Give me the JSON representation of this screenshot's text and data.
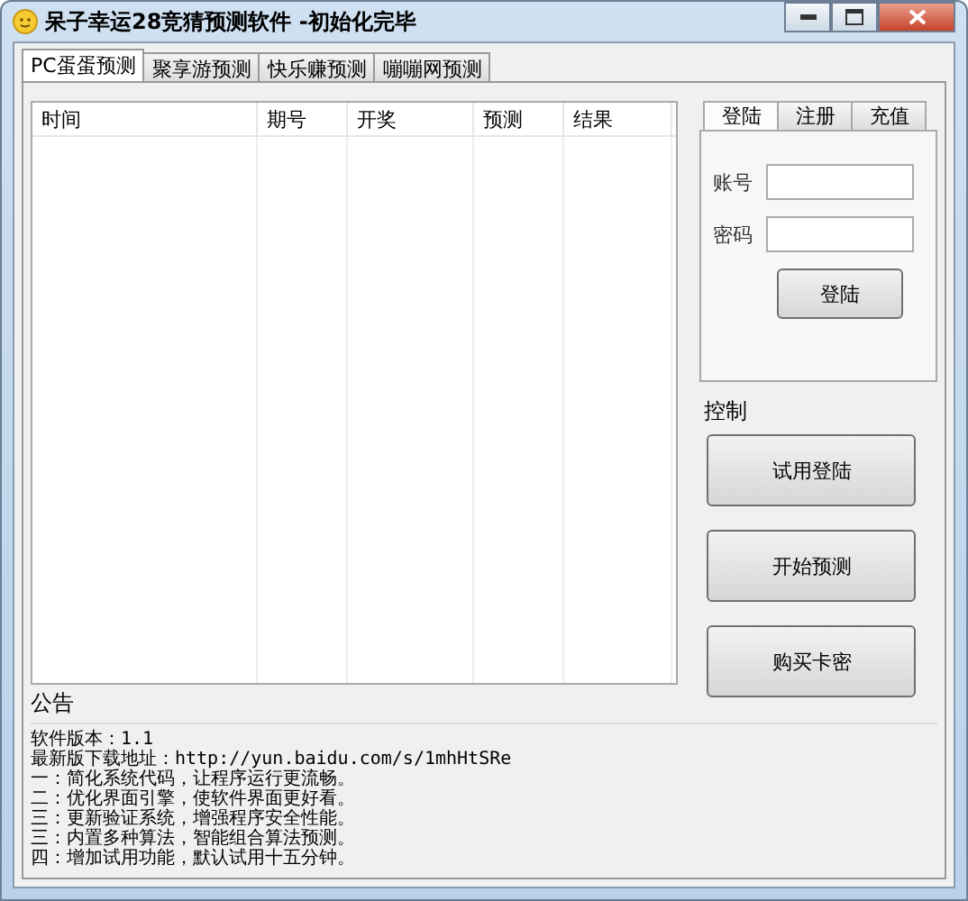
{
  "window": {
    "title": "呆子幸运28竞猜预测软件 -初始化完毕"
  },
  "tabs": [
    {
      "label": "PC蛋蛋预测",
      "selected": true
    },
    {
      "label": "聚享游预测",
      "selected": false
    },
    {
      "label": "快乐赚预测",
      "selected": false
    },
    {
      "label": "嘣嘣网预测",
      "selected": false
    }
  ],
  "table": {
    "columns": [
      "时间",
      "期号",
      "开奖",
      "预测",
      "结果"
    ]
  },
  "account": {
    "tabs": [
      {
        "label": "登陆",
        "selected": true
      },
      {
        "label": "注册",
        "selected": false
      },
      {
        "label": "充值",
        "selected": false
      }
    ],
    "fields": [
      {
        "label": "账号"
      },
      {
        "label": "密码"
      }
    ],
    "button": "登陆"
  },
  "control": {
    "title": "控制",
    "buttons": [
      "试用登陆",
      "开始预测",
      "购买卡密"
    ]
  },
  "notice": {
    "title": "公告",
    "lines": [
      "软件版本：1.1",
      "最新版下载地址：http://yun.baidu.com/s/1mhHtSRe",
      "一：简化系统代码，让程序运行更流畅。",
      "二：优化界面引擎，使软件界面更好看。",
      "三：更新验证系统，增强程序安全性能。",
      "三：内置多种算法，智能组合算法预测。",
      "四：增加试用功能，默认试用十五分钟。"
    ]
  }
}
